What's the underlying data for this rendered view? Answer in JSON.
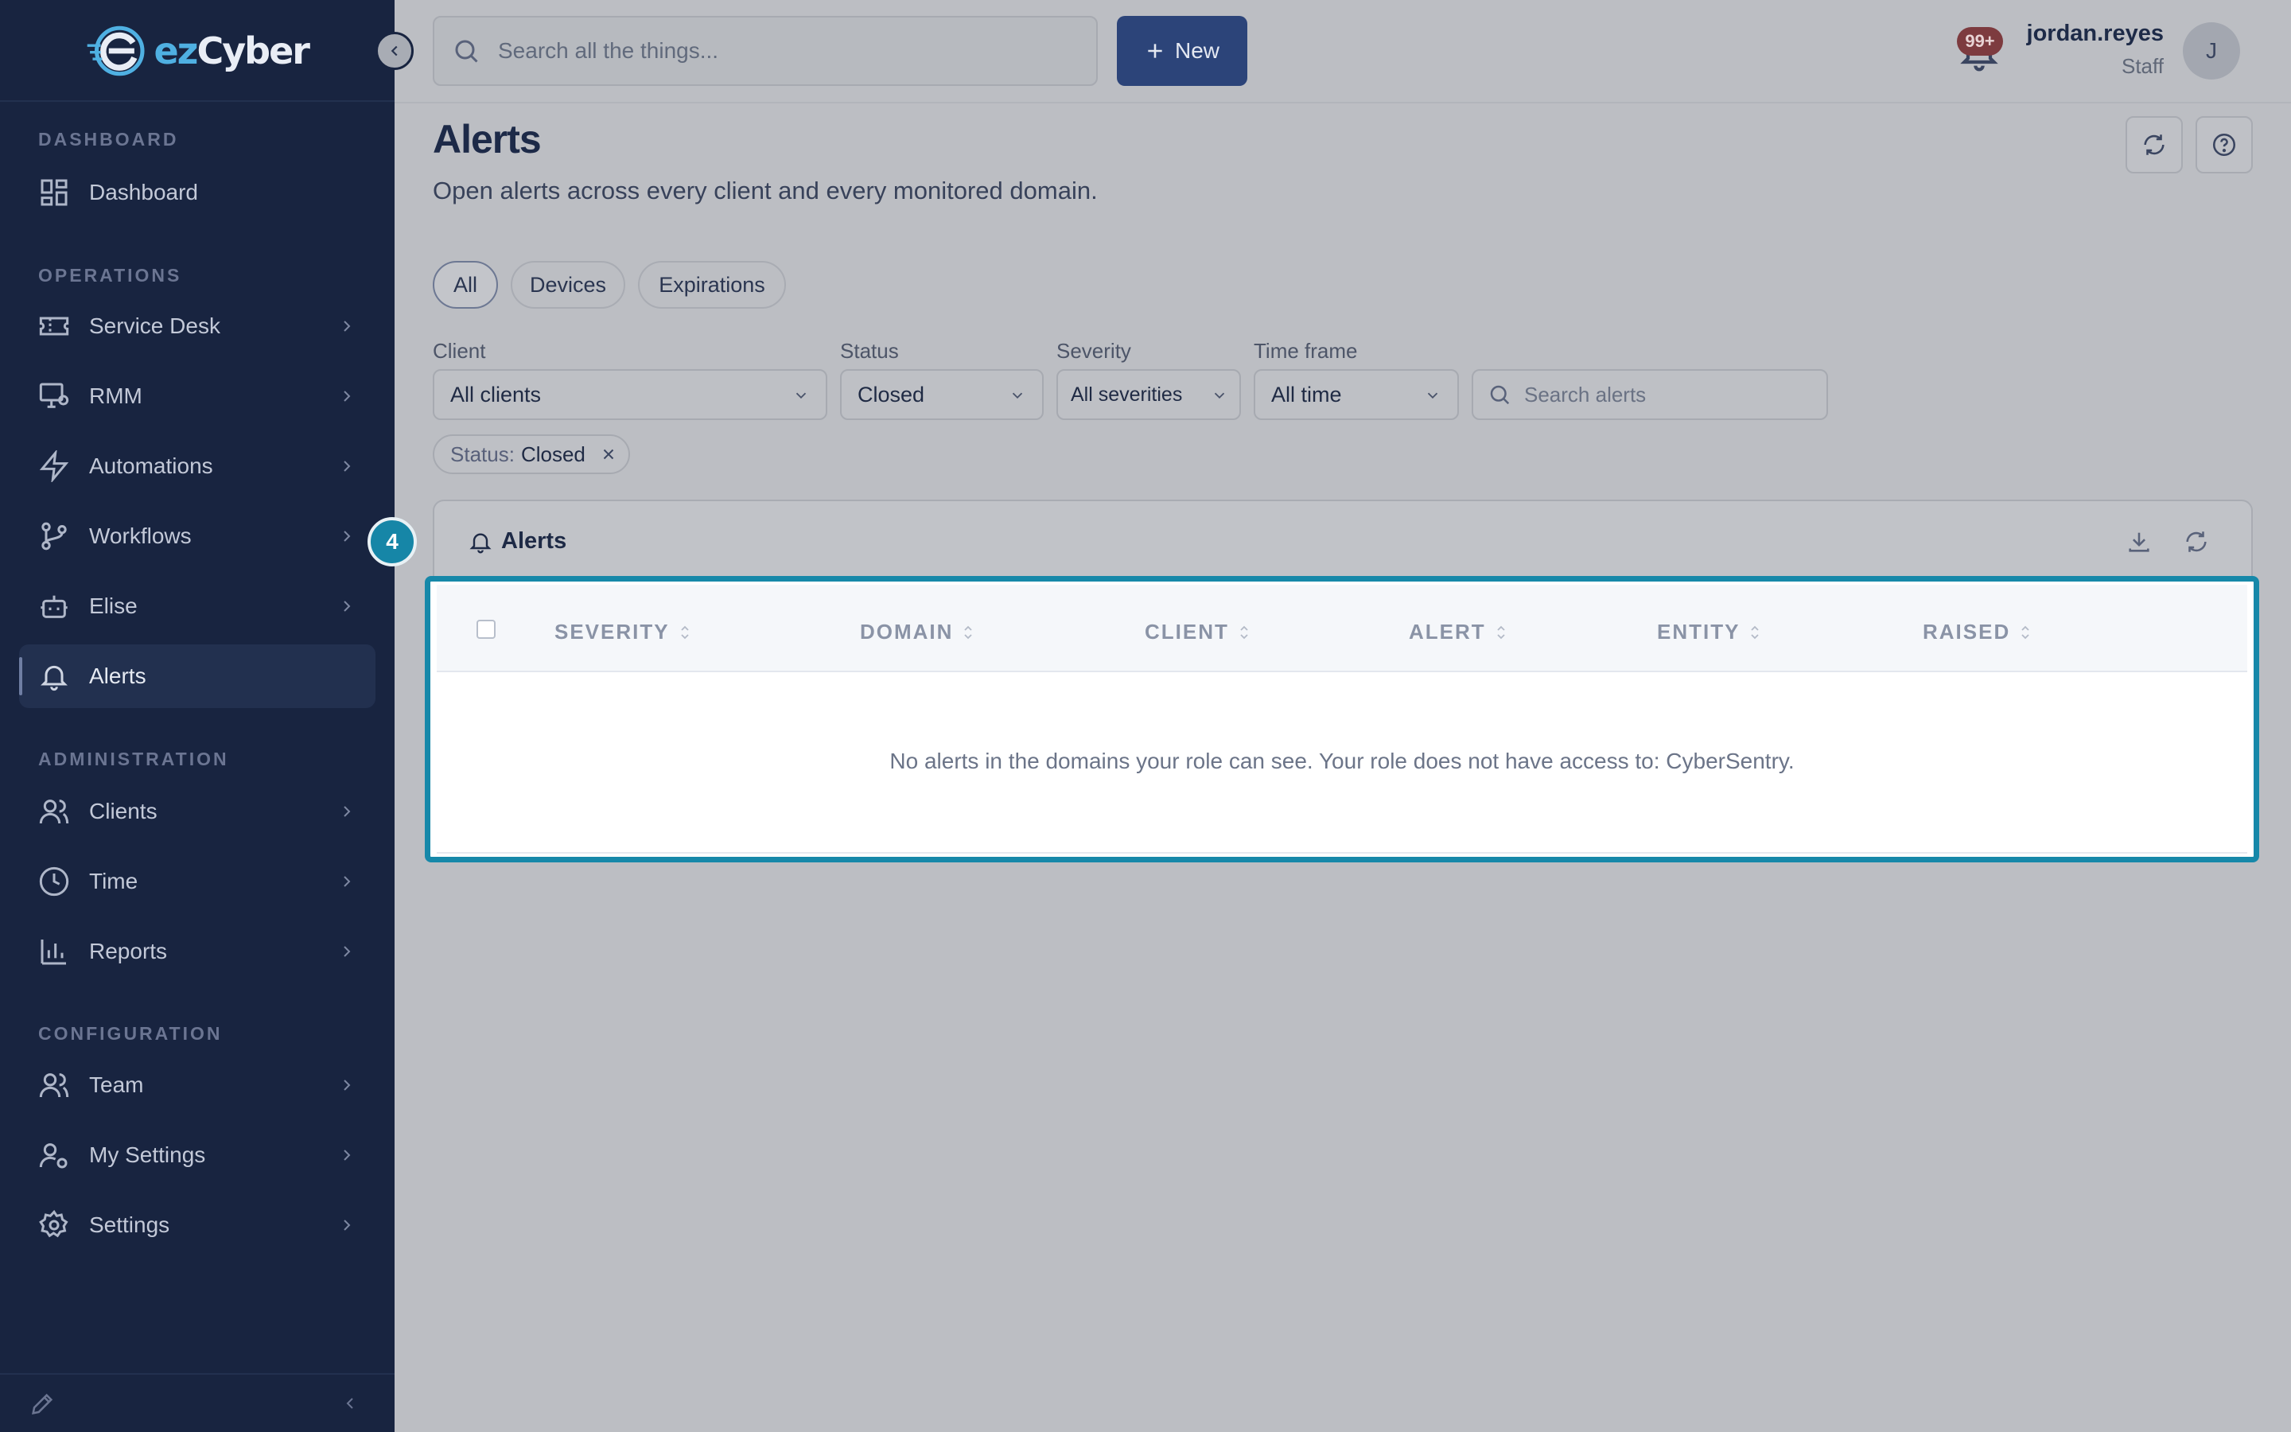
{
  "brand": {
    "logo_prefix": "ez",
    "logo_suffix": "Cyber"
  },
  "search": {
    "placeholder": "Search all the things..."
  },
  "new_button": {
    "label": "New"
  },
  "notifications": {
    "badge": "99+"
  },
  "user": {
    "name": "jordan.reyes",
    "role": "Staff",
    "initial": "J"
  },
  "sidebar": {
    "sections": [
      {
        "title": "DASHBOARD"
      },
      {
        "title": "OPERATIONS"
      },
      {
        "title": "ADMINISTRATION"
      },
      {
        "title": "CONFIGURATION"
      }
    ],
    "items": [
      {
        "label": "Dashboard",
        "icon": "dashboard-grid-icon"
      },
      {
        "label": "Service Desk",
        "icon": "ticket-icon"
      },
      {
        "label": "RMM",
        "icon": "monitor-settings-icon"
      },
      {
        "label": "Automations",
        "icon": "lightning-icon"
      },
      {
        "label": "Workflows",
        "icon": "branch-icon"
      },
      {
        "label": "Elise",
        "icon": "robot-icon"
      },
      {
        "label": "Alerts",
        "icon": "bell-icon",
        "active": true
      },
      {
        "label": "Clients",
        "icon": "users-icon"
      },
      {
        "label": "Time",
        "icon": "clock-icon"
      },
      {
        "label": "Reports",
        "icon": "bar-chart-icon"
      },
      {
        "label": "Team",
        "icon": "team-icon"
      },
      {
        "label": "My Settings",
        "icon": "user-cog-icon"
      },
      {
        "label": "Settings",
        "icon": "gear-icon"
      }
    ]
  },
  "page": {
    "title": "Alerts",
    "subtitle": "Open alerts across every client and every monitored domain."
  },
  "tabs": [
    {
      "label": "All",
      "active": true
    },
    {
      "label": "Devices"
    },
    {
      "label": "Expirations"
    }
  ],
  "filters": {
    "client": {
      "label": "Client",
      "value": "All clients"
    },
    "status": {
      "label": "Status",
      "value": "Closed"
    },
    "severity": {
      "label": "Severity",
      "value": "All severities"
    },
    "timeframe": {
      "label": "Time frame",
      "value": "All time"
    },
    "search_placeholder": "Search alerts"
  },
  "active_filter_chip": {
    "key": "Status:",
    "value": "Closed"
  },
  "alerts_card": {
    "title": "Alerts",
    "step_badge": "4",
    "columns": [
      "SEVERITY",
      "DOMAIN",
      "CLIENT",
      "ALERT",
      "ENTITY",
      "RAISED"
    ],
    "empty_message": "No alerts in the domains your role can see. Your role does not have access to: CyberSentry."
  },
  "colors": {
    "sidebar_bg": "#182440",
    "accent_primary": "#2c4479",
    "highlight_teal": "#1688a9",
    "badge_red": "#7d3b3f"
  }
}
